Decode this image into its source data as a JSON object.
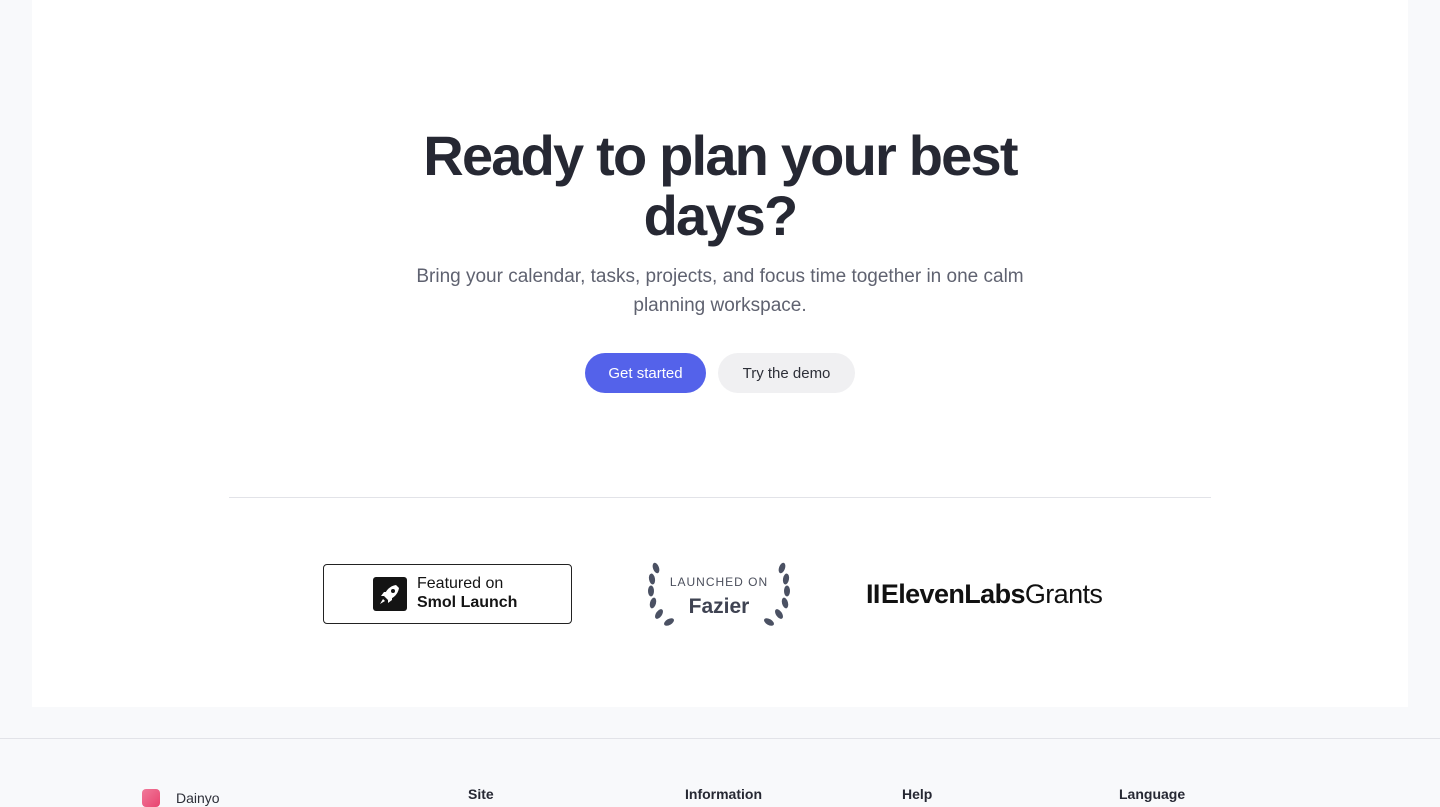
{
  "hero": {
    "title_line1": "Ready to plan your best",
    "title_line2": "days?",
    "subtitle_line1": "Bring your calendar, tasks, projects, and focus time together in one calm",
    "subtitle_line2": "planning workspace.",
    "primary_button": "Get started",
    "secondary_button": "Try the demo"
  },
  "badges": {
    "smol": {
      "line1": "Featured on",
      "line2": "Smol Launch",
      "icon": "rocket-icon"
    },
    "fazier": {
      "line1": "LAUNCHED ON",
      "line2": "Fazier",
      "icon": "laurel-icon"
    },
    "eleven": {
      "bars": "II",
      "brand": "ElevenLabs",
      "suffix": "Grants"
    }
  },
  "footer": {
    "brand": "Dainyo",
    "columns": [
      "Site",
      "Information",
      "Help",
      "Language"
    ]
  },
  "colors": {
    "accent": "#5462ea",
    "text": "#262833",
    "muted": "#5f6270",
    "page_bg": "#f8f9fb"
  }
}
